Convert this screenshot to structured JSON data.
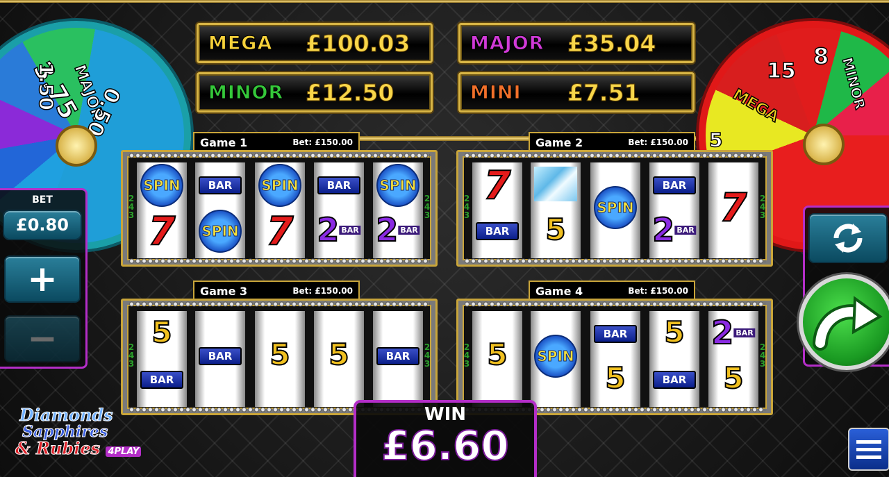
{
  "jackpots": {
    "mega": {
      "name": "MEGA",
      "value": "£100.03",
      "color": "#f6d23a"
    },
    "major": {
      "name": "MAJOR",
      "value": "£35.04",
      "color": "#d13ad8"
    },
    "minor": {
      "name": "MINOR",
      "value": "£12.50",
      "color": "#35c83a"
    },
    "mini": {
      "name": "MINI",
      "value": "£7.51",
      "color": "#f2702a"
    }
  },
  "left_wheel": {
    "labels": [
      "3.75",
      "1.50",
      "MAJOR",
      "0.50"
    ]
  },
  "right_wheel": {
    "labels": [
      "15",
      "8",
      "MINOR",
      "MEGA",
      "5"
    ]
  },
  "games": [
    {
      "name": "Game 1",
      "bet": "Bet: £150.00",
      "lines": "243",
      "reels": [
        [
          "spin",
          "seven"
        ],
        [
          "bar",
          "spin"
        ],
        [
          "spin",
          "seven"
        ],
        [
          "bar",
          "two"
        ],
        [
          "spin",
          "two"
        ]
      ]
    },
    {
      "name": "Game 2",
      "bet": "Bet: £150.00",
      "lines": "243",
      "reels": [
        [
          "seven",
          "bar"
        ],
        [
          "diamond",
          "five"
        ],
        [
          "spin"
        ],
        [
          "bar",
          "two"
        ],
        [
          "seven"
        ]
      ]
    },
    {
      "name": "Game 3",
      "bet": "Bet: £150.00",
      "lines": "243",
      "reels": [
        [
          "five",
          "bar"
        ],
        [
          "bar"
        ],
        [
          "five"
        ],
        [
          "five"
        ],
        [
          "bar"
        ]
      ]
    },
    {
      "name": "Game 4",
      "bet": "Bet: £150.00",
      "lines": "243",
      "reels": [
        [
          "five"
        ],
        [
          "spin"
        ],
        [
          "bar",
          "five"
        ],
        [
          "five",
          "bar"
        ],
        [
          "two",
          "five"
        ]
      ]
    }
  ],
  "symbols": {
    "spin": "SPIN",
    "bar": "BAR",
    "seven": "7",
    "two": "2",
    "two_tag": "BAR",
    "five": "5",
    "five_tag": "BAR"
  },
  "bet_panel": {
    "label": "BET",
    "value": "£0.80",
    "plus": "+",
    "minus": "−"
  },
  "win": {
    "label": "WIN",
    "value": "£6.60"
  },
  "logo": {
    "line1": "Diamonds",
    "line2": "Sapphires",
    "line3": "& Rubies",
    "badge": "4PLAY"
  },
  "icons": {
    "autoplay": "refresh-icon",
    "spin": "arrow-icon",
    "menu": "hamburger-icon"
  }
}
